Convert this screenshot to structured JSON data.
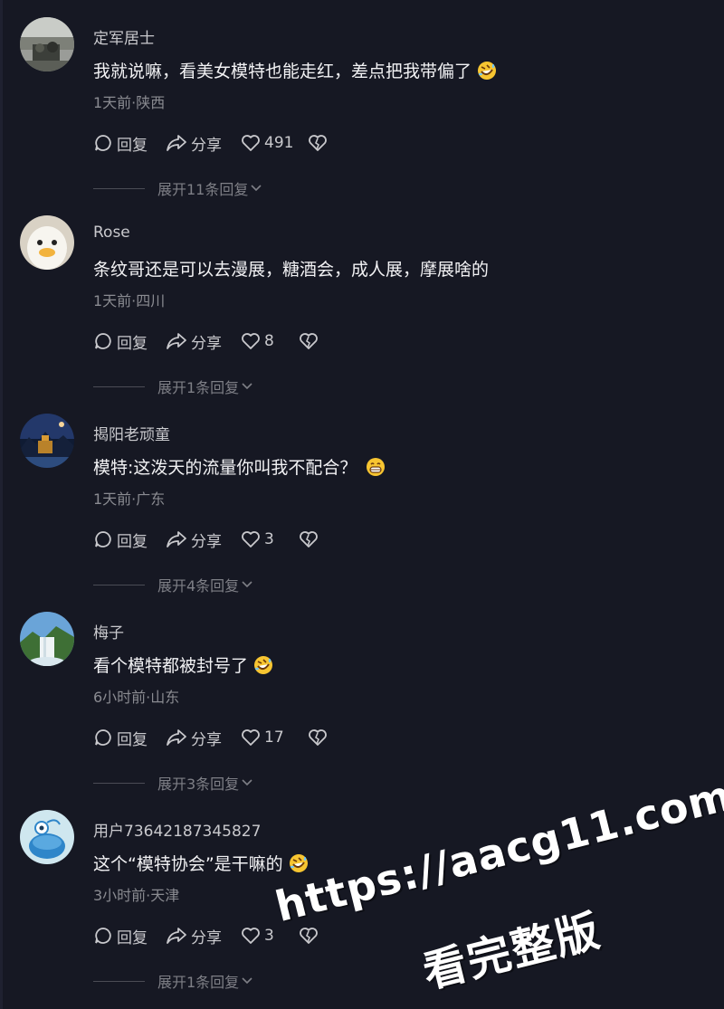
{
  "comments": [
    {
      "username": "定军居士",
      "text": "我就说嘛，看美女模特也能走红，差点把我带偏了",
      "emoji": "rofl-emoji",
      "meta": "1天前·陕西",
      "reply_label": "回复",
      "share_label": "分享",
      "likes": "491",
      "expand_label": "展开11条回复"
    },
    {
      "username": "Rose",
      "text": "条纹哥还是可以去漫展，糖酒会，成人展，摩展啥的",
      "emoji": "",
      "meta": "1天前·四川",
      "reply_label": "回复",
      "share_label": "分享",
      "likes": "8",
      "expand_label": "展开1条回复"
    },
    {
      "username": "揭阳老顽童",
      "text": "模特:这泼天的流量你叫我不配合？",
      "emoji": "grin-emoji",
      "meta": "1天前·广东",
      "reply_label": "回复",
      "share_label": "分享",
      "likes": "3",
      "expand_label": "展开4条回复"
    },
    {
      "username": "梅子",
      "text": "看个模特都被封号了",
      "emoji": "rofl-emoji",
      "meta": "6小时前·山东",
      "reply_label": "回复",
      "share_label": "分享",
      "likes": "17",
      "expand_label": "展开3条回复"
    },
    {
      "username": "用户73642187345827",
      "text": "这个“模特协会”是干嘛的",
      "emoji": "rofl-emoji",
      "meta": "3小时前·天津",
      "reply_label": "回复",
      "share_label": "分享",
      "likes": "3",
      "expand_label": "展开1条回复"
    }
  ],
  "watermark": {
    "line1": "https://aacg11.com",
    "line2": "看完整版"
  },
  "colors": {
    "background": "#161823",
    "primary_text": "#f2f2f4",
    "secondary_text": "#8a8b91",
    "emoji_yellow": "#f7c531"
  }
}
